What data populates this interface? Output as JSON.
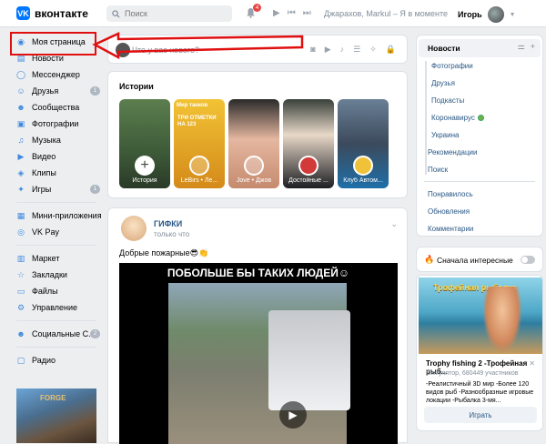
{
  "header": {
    "brand": "вконтакте",
    "logo_letter": "VK",
    "search_placeholder": "Поиск",
    "notifications_count": "4",
    "now_playing": "Джарахов, Markul – Я в моменте",
    "user_name": "Игорь"
  },
  "sidebar": {
    "items": [
      {
        "label": "Моя страница",
        "icon": "user-icon"
      },
      {
        "label": "Новости",
        "icon": "news-icon"
      },
      {
        "label": "Мессенджер",
        "icon": "chat-icon"
      },
      {
        "label": "Друзья",
        "icon": "friends-icon",
        "count": "1"
      },
      {
        "label": "Сообщества",
        "icon": "community-icon"
      },
      {
        "label": "Фотографии",
        "icon": "photo-icon"
      },
      {
        "label": "Музыка",
        "icon": "music-icon"
      },
      {
        "label": "Видео",
        "icon": "video-icon"
      },
      {
        "label": "Клипы",
        "icon": "clips-icon"
      },
      {
        "label": "Игры",
        "icon": "games-icon",
        "count": "1"
      },
      {
        "label": "Мини-приложения",
        "icon": "apps-icon"
      },
      {
        "label": "VK Pay",
        "icon": "vkpay-icon"
      },
      {
        "label": "Маркет",
        "icon": "market-icon"
      },
      {
        "label": "Закладки",
        "icon": "bookmark-icon"
      },
      {
        "label": "Файлы",
        "icon": "file-icon"
      },
      {
        "label": "Управление",
        "icon": "manage-icon"
      },
      {
        "label": "Социальные С...",
        "icon": "social-icon",
        "count": "2"
      },
      {
        "label": "Радио",
        "icon": "radio-icon"
      }
    ],
    "ad_label": "FORGE"
  },
  "composer": {
    "placeholder": "Что у вас нового?"
  },
  "stories": {
    "title": "Истории",
    "items": [
      {
        "caption": "История"
      },
      {
        "caption": "LeBirs • Ле...",
        "top": "Мир танков",
        "headline": "ТРИ ОТМЕТКИ НА 123"
      },
      {
        "caption": "Jove • Джов"
      },
      {
        "caption": "Достойные ..."
      },
      {
        "caption": "Клуб Автом..."
      }
    ]
  },
  "post": {
    "author": "ГИФКИ",
    "time": "только что",
    "text": "Добрые пожарные😎👏",
    "headline": "ПОБОЛЬШЕ БЫ ТАКИХ ЛЮДЕЙ☺"
  },
  "right_nav": {
    "active": "Новости",
    "sub_items": [
      "Фотографии",
      "Друзья",
      "Подкасты",
      "Коронавирус",
      "Украина"
    ],
    "items": [
      "Рекомендации",
      "Поиск"
    ],
    "items2": [
      "Понравилось",
      "Обновления",
      "Комментарии"
    ]
  },
  "sort": {
    "label": "Сначала интересные"
  },
  "ad": {
    "brand_text": "Трофейная рыбалка",
    "title": "Trophy fishing 2 -Трофейная рыб...",
    "subtitle": "Симулятор, 680449 участников",
    "description": "-Реалистичный 3D мир -Более 120 видов рыб -Разнообразные игровые локации -Рыбалка 3-мя...",
    "button": "Играть"
  }
}
